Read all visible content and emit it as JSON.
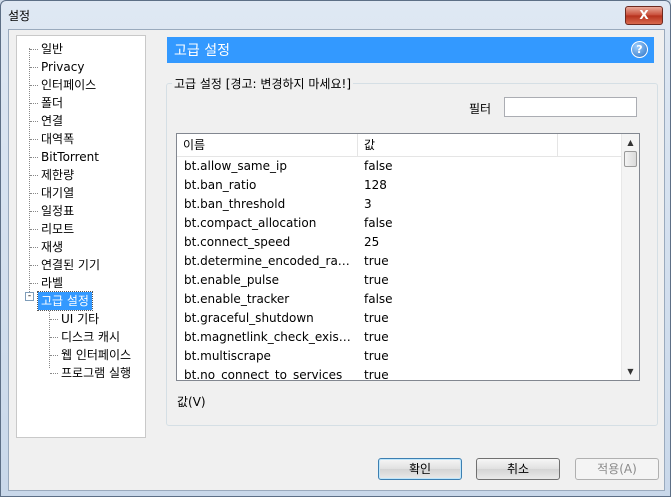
{
  "window": {
    "title": "설정",
    "close_label": "X"
  },
  "tree": {
    "items": [
      "일반",
      "Privacy",
      "인터페이스",
      "폴더",
      "연결",
      "대역폭",
      "BitTorrent",
      "제한량",
      "대기열",
      "일정표",
      "리모트",
      "재생",
      "연결된 기기",
      "라벨"
    ],
    "selected": "고급 설정",
    "children": [
      "UI 기타",
      "디스크 캐시",
      "웹 인터페이스",
      "프로그램 실행"
    ],
    "expander": "-"
  },
  "header": {
    "title": "고급 설정",
    "help": "?"
  },
  "group": {
    "legend": "고급 설정 [경고: 변경하지 마세요!]",
    "filter_label": "필터",
    "filter_value": ""
  },
  "table": {
    "columns": [
      "이름",
      "값"
    ],
    "rows": [
      {
        "name": "bt.allow_same_ip",
        "value": "false"
      },
      {
        "name": "bt.ban_ratio",
        "value": "128"
      },
      {
        "name": "bt.ban_threshold",
        "value": "3"
      },
      {
        "name": "bt.compact_allocation",
        "value": "false"
      },
      {
        "name": "bt.connect_speed",
        "value": "25"
      },
      {
        "name": "bt.determine_encoded_rate_fo...",
        "value": "true"
      },
      {
        "name": "bt.enable_pulse",
        "value": "true"
      },
      {
        "name": "bt.enable_tracker",
        "value": "false"
      },
      {
        "name": "bt.graceful_shutdown",
        "value": "true"
      },
      {
        "name": "bt.magnetlink_check_existing_...",
        "value": "true"
      },
      {
        "name": "bt.multiscrape",
        "value": "true"
      },
      {
        "name": "bt.no_connect_to_services",
        "value": "true"
      }
    ],
    "scroll_up": "▲",
    "scroll_down": "▼"
  },
  "value_label": "값(V)",
  "buttons": {
    "ok": "확인",
    "cancel": "취소",
    "apply": "적용(A)"
  }
}
